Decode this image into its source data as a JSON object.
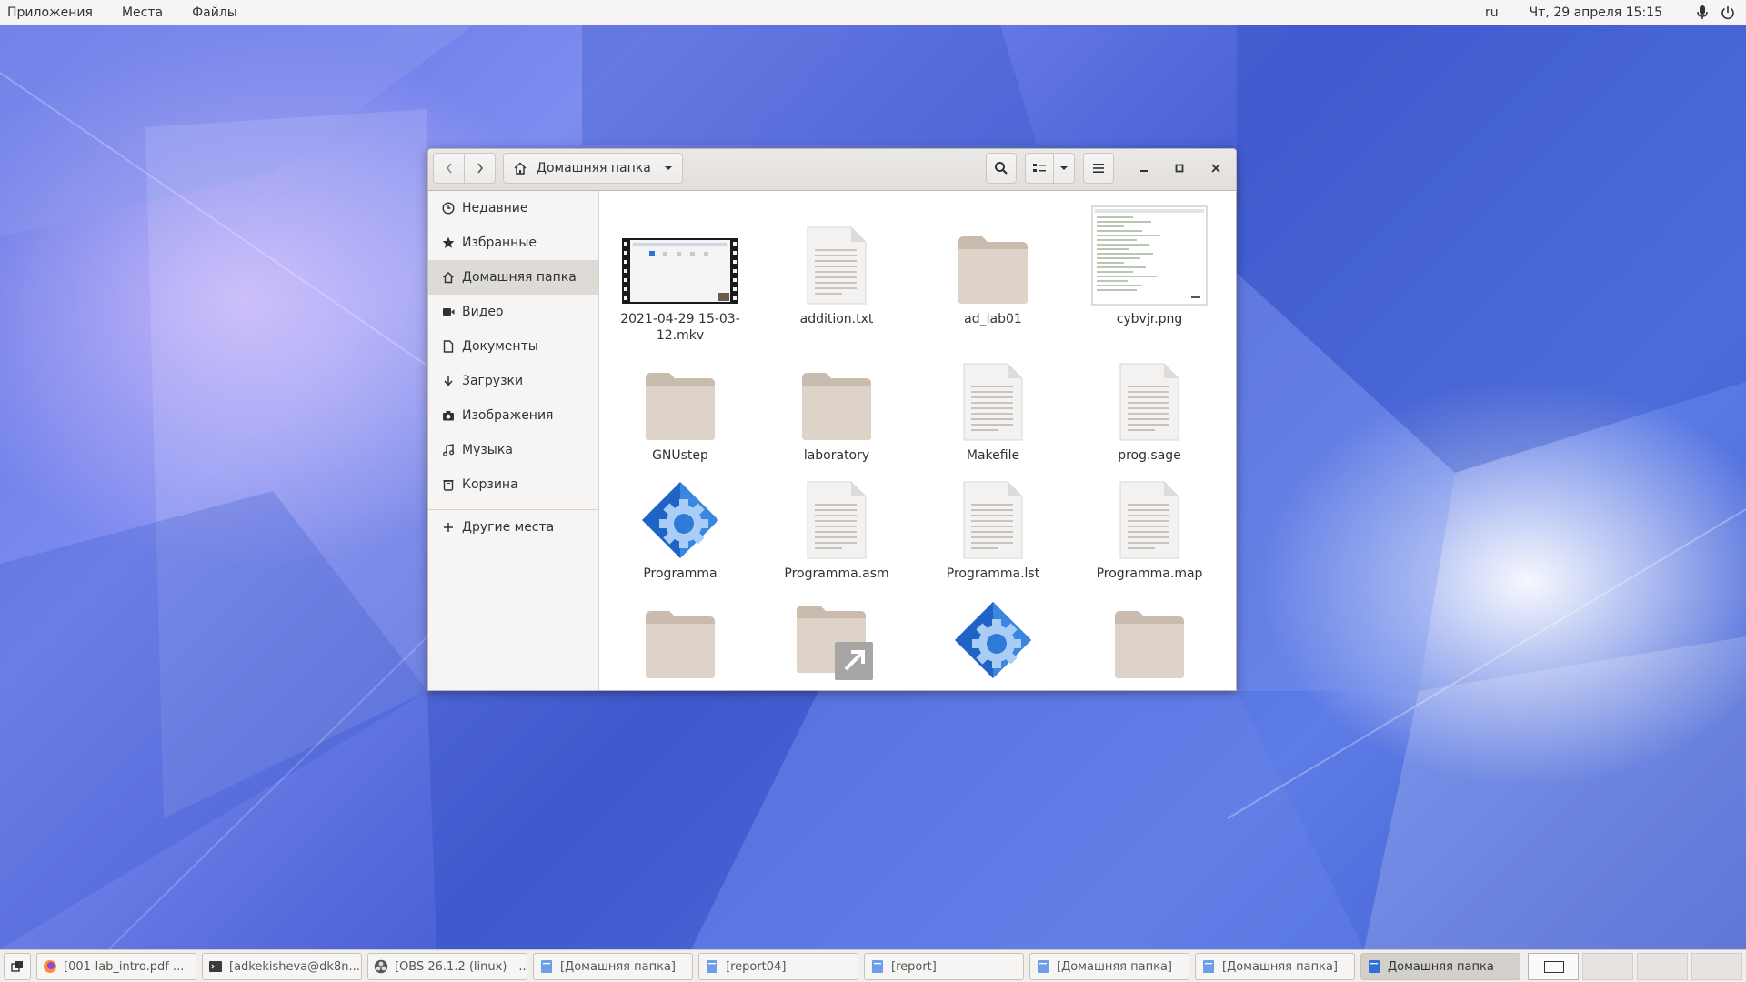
{
  "topbar": {
    "menus": [
      "Приложения",
      "Места",
      "Файлы"
    ],
    "lang": "ru",
    "clock": "Чт, 29 апреля  15:15",
    "icons": [
      "microphone-icon",
      "power-icon"
    ]
  },
  "window": {
    "path_label": "Домашняя папка",
    "sidebar": {
      "items": [
        {
          "label": "Недавние",
          "icon": "clock-icon"
        },
        {
          "label": "Избранные",
          "icon": "star-icon"
        },
        {
          "label": "Домашняя папка",
          "icon": "home-icon",
          "active": true
        },
        {
          "label": "Видео",
          "icon": "video-icon"
        },
        {
          "label": "Документы",
          "icon": "document-icon"
        },
        {
          "label": "Загрузки",
          "icon": "download-icon"
        },
        {
          "label": "Изображения",
          "icon": "camera-icon"
        },
        {
          "label": "Музыка",
          "icon": "music-icon"
        },
        {
          "label": "Корзина",
          "icon": "trash-icon"
        }
      ],
      "other_places": "Другие места"
    },
    "files": [
      {
        "name": "2021-04-29 15-03-12.mkv",
        "type": "video"
      },
      {
        "name": "addition.txt",
        "type": "text"
      },
      {
        "name": "ad_lab01",
        "type": "folder"
      },
      {
        "name": "cybvjr.png",
        "type": "image"
      },
      {
        "name": "GNUstep",
        "type": "folder"
      },
      {
        "name": "laboratory",
        "type": "folder"
      },
      {
        "name": "Makefile",
        "type": "text"
      },
      {
        "name": "prog.sage",
        "type": "text"
      },
      {
        "name": "Programma",
        "type": "executable"
      },
      {
        "name": "Programma.asm",
        "type": "text"
      },
      {
        "name": "Programma.lst",
        "type": "text"
      },
      {
        "name": "Programma.map",
        "type": "text"
      },
      {
        "name": "",
        "type": "folder"
      },
      {
        "name": "",
        "type": "folder-link"
      },
      {
        "name": "",
        "type": "executable"
      },
      {
        "name": "",
        "type": "folder"
      }
    ]
  },
  "taskbar": {
    "tasks": [
      {
        "label": "[001-lab_intro.pdf ...",
        "icon": "firefox-icon"
      },
      {
        "label": "[adkekisheva@dk8n...",
        "icon": "terminal-icon"
      },
      {
        "label": "[OBS 26.1.2 (linux) - ...",
        "icon": "obs-icon"
      },
      {
        "label": "[Домашняя папка]",
        "icon": "files-icon"
      },
      {
        "label": "[report04]",
        "icon": "files-icon"
      },
      {
        "label": "[report]",
        "icon": "files-icon"
      },
      {
        "label": "[Домашняя папка]",
        "icon": "files-icon"
      },
      {
        "label": "[Домашняя папка]",
        "icon": "files-icon"
      },
      {
        "label": "Домашняя папка",
        "icon": "files-icon",
        "active": true
      }
    ],
    "workspaces": 4
  }
}
